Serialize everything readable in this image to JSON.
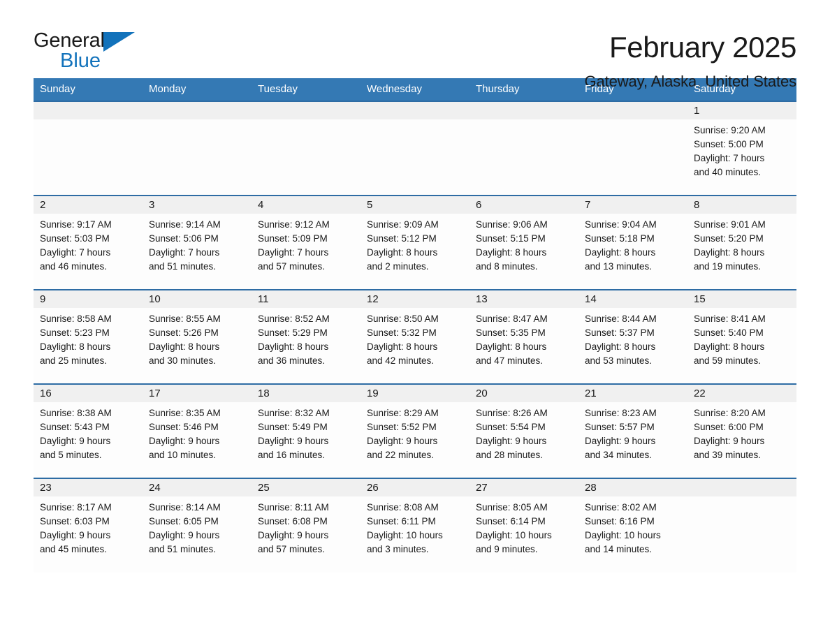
{
  "brand": {
    "name_part1": "General",
    "name_part2": "Blue",
    "triangle_icon": "blue-triangle-logo-mark",
    "color_black": "#1a1a1a",
    "color_blue": "#1272bb"
  },
  "header": {
    "title": "February 2025",
    "location": "Gateway, Alaska, United States"
  },
  "theme": {
    "header_bg": "#3479b4",
    "row_border": "#2e6ca4",
    "daynum_bg": "#f0f0f0",
    "cell_bg": "#fdfdfd"
  },
  "weekdays": [
    "Sunday",
    "Monday",
    "Tuesday",
    "Wednesday",
    "Thursday",
    "Friday",
    "Saturday"
  ],
  "labels": {
    "sunrise": "Sunrise:",
    "sunset": "Sunset:",
    "daylight": "Daylight:"
  },
  "weeks": [
    [
      {
        "day": ""
      },
      {
        "day": ""
      },
      {
        "day": ""
      },
      {
        "day": ""
      },
      {
        "day": ""
      },
      {
        "day": ""
      },
      {
        "day": "1",
        "sunrise": "Sunrise: 9:20 AM",
        "sunset": "Sunset: 5:00 PM",
        "daylight_line1": "Daylight: 7 hours",
        "daylight_line2": "and 40 minutes."
      }
    ],
    [
      {
        "day": "2",
        "sunrise": "Sunrise: 9:17 AM",
        "sunset": "Sunset: 5:03 PM",
        "daylight_line1": "Daylight: 7 hours",
        "daylight_line2": "and 46 minutes."
      },
      {
        "day": "3",
        "sunrise": "Sunrise: 9:14 AM",
        "sunset": "Sunset: 5:06 PM",
        "daylight_line1": "Daylight: 7 hours",
        "daylight_line2": "and 51 minutes."
      },
      {
        "day": "4",
        "sunrise": "Sunrise: 9:12 AM",
        "sunset": "Sunset: 5:09 PM",
        "daylight_line1": "Daylight: 7 hours",
        "daylight_line2": "and 57 minutes."
      },
      {
        "day": "5",
        "sunrise": "Sunrise: 9:09 AM",
        "sunset": "Sunset: 5:12 PM",
        "daylight_line1": "Daylight: 8 hours",
        "daylight_line2": "and 2 minutes."
      },
      {
        "day": "6",
        "sunrise": "Sunrise: 9:06 AM",
        "sunset": "Sunset: 5:15 PM",
        "daylight_line1": "Daylight: 8 hours",
        "daylight_line2": "and 8 minutes."
      },
      {
        "day": "7",
        "sunrise": "Sunrise: 9:04 AM",
        "sunset": "Sunset: 5:18 PM",
        "daylight_line1": "Daylight: 8 hours",
        "daylight_line2": "and 13 minutes."
      },
      {
        "day": "8",
        "sunrise": "Sunrise: 9:01 AM",
        "sunset": "Sunset: 5:20 PM",
        "daylight_line1": "Daylight: 8 hours",
        "daylight_line2": "and 19 minutes."
      }
    ],
    [
      {
        "day": "9",
        "sunrise": "Sunrise: 8:58 AM",
        "sunset": "Sunset: 5:23 PM",
        "daylight_line1": "Daylight: 8 hours",
        "daylight_line2": "and 25 minutes."
      },
      {
        "day": "10",
        "sunrise": "Sunrise: 8:55 AM",
        "sunset": "Sunset: 5:26 PM",
        "daylight_line1": "Daylight: 8 hours",
        "daylight_line2": "and 30 minutes."
      },
      {
        "day": "11",
        "sunrise": "Sunrise: 8:52 AM",
        "sunset": "Sunset: 5:29 PM",
        "daylight_line1": "Daylight: 8 hours",
        "daylight_line2": "and 36 minutes."
      },
      {
        "day": "12",
        "sunrise": "Sunrise: 8:50 AM",
        "sunset": "Sunset: 5:32 PM",
        "daylight_line1": "Daylight: 8 hours",
        "daylight_line2": "and 42 minutes."
      },
      {
        "day": "13",
        "sunrise": "Sunrise: 8:47 AM",
        "sunset": "Sunset: 5:35 PM",
        "daylight_line1": "Daylight: 8 hours",
        "daylight_line2": "and 47 minutes."
      },
      {
        "day": "14",
        "sunrise": "Sunrise: 8:44 AM",
        "sunset": "Sunset: 5:37 PM",
        "daylight_line1": "Daylight: 8 hours",
        "daylight_line2": "and 53 minutes."
      },
      {
        "day": "15",
        "sunrise": "Sunrise: 8:41 AM",
        "sunset": "Sunset: 5:40 PM",
        "daylight_line1": "Daylight: 8 hours",
        "daylight_line2": "and 59 minutes."
      }
    ],
    [
      {
        "day": "16",
        "sunrise": "Sunrise: 8:38 AM",
        "sunset": "Sunset: 5:43 PM",
        "daylight_line1": "Daylight: 9 hours",
        "daylight_line2": "and 5 minutes."
      },
      {
        "day": "17",
        "sunrise": "Sunrise: 8:35 AM",
        "sunset": "Sunset: 5:46 PM",
        "daylight_line1": "Daylight: 9 hours",
        "daylight_line2": "and 10 minutes."
      },
      {
        "day": "18",
        "sunrise": "Sunrise: 8:32 AM",
        "sunset": "Sunset: 5:49 PM",
        "daylight_line1": "Daylight: 9 hours",
        "daylight_line2": "and 16 minutes."
      },
      {
        "day": "19",
        "sunrise": "Sunrise: 8:29 AM",
        "sunset": "Sunset: 5:52 PM",
        "daylight_line1": "Daylight: 9 hours",
        "daylight_line2": "and 22 minutes."
      },
      {
        "day": "20",
        "sunrise": "Sunrise: 8:26 AM",
        "sunset": "Sunset: 5:54 PM",
        "daylight_line1": "Daylight: 9 hours",
        "daylight_line2": "and 28 minutes."
      },
      {
        "day": "21",
        "sunrise": "Sunrise: 8:23 AM",
        "sunset": "Sunset: 5:57 PM",
        "daylight_line1": "Daylight: 9 hours",
        "daylight_line2": "and 34 minutes."
      },
      {
        "day": "22",
        "sunrise": "Sunrise: 8:20 AM",
        "sunset": "Sunset: 6:00 PM",
        "daylight_line1": "Daylight: 9 hours",
        "daylight_line2": "and 39 minutes."
      }
    ],
    [
      {
        "day": "23",
        "sunrise": "Sunrise: 8:17 AM",
        "sunset": "Sunset: 6:03 PM",
        "daylight_line1": "Daylight: 9 hours",
        "daylight_line2": "and 45 minutes."
      },
      {
        "day": "24",
        "sunrise": "Sunrise: 8:14 AM",
        "sunset": "Sunset: 6:05 PM",
        "daylight_line1": "Daylight: 9 hours",
        "daylight_line2": "and 51 minutes."
      },
      {
        "day": "25",
        "sunrise": "Sunrise: 8:11 AM",
        "sunset": "Sunset: 6:08 PM",
        "daylight_line1": "Daylight: 9 hours",
        "daylight_line2": "and 57 minutes."
      },
      {
        "day": "26",
        "sunrise": "Sunrise: 8:08 AM",
        "sunset": "Sunset: 6:11 PM",
        "daylight_line1": "Daylight: 10 hours",
        "daylight_line2": "and 3 minutes."
      },
      {
        "day": "27",
        "sunrise": "Sunrise: 8:05 AM",
        "sunset": "Sunset: 6:14 PM",
        "daylight_line1": "Daylight: 10 hours",
        "daylight_line2": "and 9 minutes."
      },
      {
        "day": "28",
        "sunrise": "Sunrise: 8:02 AM",
        "sunset": "Sunset: 6:16 PM",
        "daylight_line1": "Daylight: 10 hours",
        "daylight_line2": "and 14 minutes."
      },
      {
        "day": ""
      }
    ]
  ]
}
